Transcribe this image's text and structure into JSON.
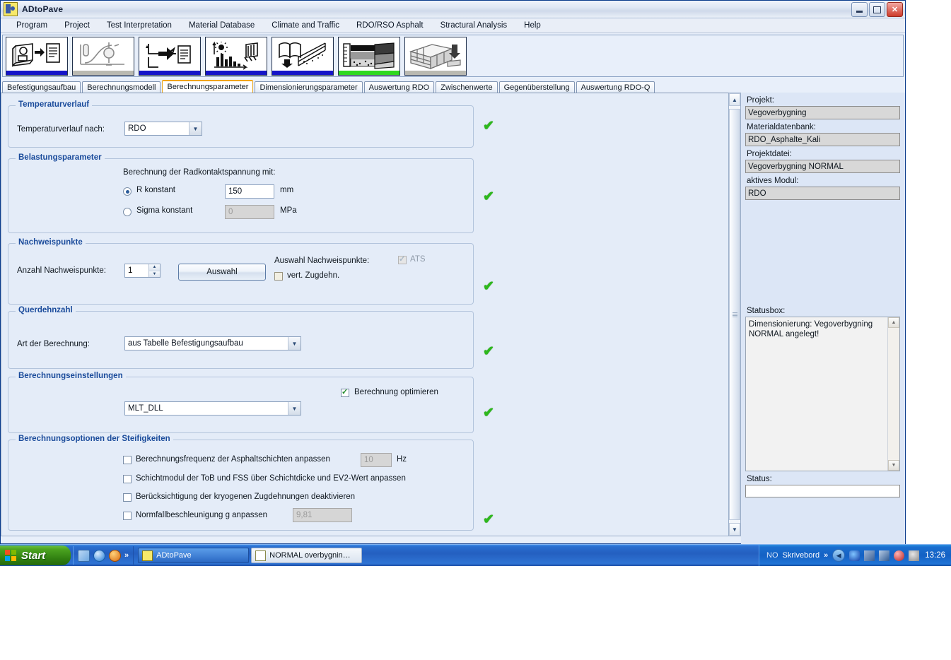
{
  "window": {
    "title": "ADtoPave",
    "app_icon": "app-icon",
    "controls": {
      "minimize": "Minimize",
      "maximize": "Maximize",
      "close": "Close"
    }
  },
  "menubar": {
    "items": [
      "Program",
      "Project",
      "Test Interpretation",
      "Material Database",
      "Climate and Traffic",
      "RDO/RSO Asphalt",
      "Stractural Analysis",
      "Help"
    ]
  },
  "toolbar": {
    "buttons": [
      {
        "name": "project-data-icon",
        "bar": "blue"
      },
      {
        "name": "test-interpretation-icon",
        "bar": "gray"
      },
      {
        "name": "material-flow-icon",
        "bar": "blue"
      },
      {
        "name": "climate-traffic-icon",
        "bar": "blue"
      },
      {
        "name": "material-database-icon",
        "bar": "blue"
      },
      {
        "name": "rdo-rso-asphalt-icon",
        "bar": "green"
      },
      {
        "name": "structural-analysis-icon",
        "bar": "gray"
      }
    ]
  },
  "tabs": [
    {
      "label": "Befestigungsaufbau",
      "active": false
    },
    {
      "label": "Berechnungsmodell",
      "active": false
    },
    {
      "label": "Berechnungsparameter",
      "active": true
    },
    {
      "label": "Dimensionierungsparameter",
      "active": false
    },
    {
      "label": "Auswertung RDO",
      "active": false
    },
    {
      "label": "Zwischenwerte",
      "active": false
    },
    {
      "label": "Gegenüberstellung",
      "active": false
    },
    {
      "label": "Auswertung RDO-Q",
      "active": false
    }
  ],
  "form": {
    "temperature": {
      "legend": "Temperaturverlauf",
      "label": "Temperaturverlauf nach:",
      "combo_value": "RDO",
      "status": "✔"
    },
    "load": {
      "legend": "Belastungsparameter",
      "heading": "Berechnung der Radkontaktspannung mit:",
      "radio_r_label": "R konstant",
      "radio_r_selected": true,
      "r_value": "150",
      "r_unit": "mm",
      "radio_sigma_label": "Sigma konstant",
      "radio_sigma_selected": false,
      "sigma_value": "0",
      "sigma_unit": "MPa",
      "status": "✔"
    },
    "points": {
      "legend": "Nachweispunkte",
      "count_label": "Anzahl Nachweispunkte:",
      "count_value": "1",
      "button_label": "Auswahl",
      "selection_label": "Auswahl Nachweispunkte:",
      "ats_label": "ATS",
      "ats_checked": true,
      "vert_label": "vert. Zugdehn.",
      "vert_checked": false,
      "status": "✔"
    },
    "poisson": {
      "legend": "Querdehnzahl",
      "label": "Art der Berechnung:",
      "combo_value": "aus Tabelle Befestigungsaufbau",
      "status": "✔"
    },
    "settings": {
      "legend": "Berechnungseinstellungen",
      "combo_value": "MLT_DLL",
      "optimize_label": "Berechnung optimieren",
      "optimize_checked": true,
      "status": "✔"
    },
    "stiffness": {
      "legend": "Berechnungsoptionen der Steifigkeiten",
      "opt1_label": "Berechnungsfrequenz der Asphaltschichten anpassen",
      "opt1_checked": false,
      "opt1_value": "10",
      "opt1_unit": "Hz",
      "opt2_label": "Schichtmodul der ToB und FSS über Schichtdicke und EV2-Wert anpassen",
      "opt2_checked": false,
      "opt3_label": "Berücksichtigung der kryogenen Zugdehnungen deaktivieren",
      "opt3_checked": false,
      "opt4_label": "Normfallbeschleunigung g anpassen",
      "opt4_checked": false,
      "opt4_value": "9,81",
      "status": "✔"
    }
  },
  "sidebar": {
    "project_label": "Projekt:",
    "project_value": "Vegoverbygning",
    "materialdb_label": "Materialdatenbank:",
    "materialdb_value": "RDO_Asphalte_Kali",
    "projectfile_label": "Projektdatei:",
    "projectfile_value": "Vegoverbygning NORMAL",
    "module_label": "aktives Modul:",
    "module_value": "RDO",
    "statusbox_label": "Statusbox:",
    "statusbox_text": "Dimensionierung: Vegoverbygning NORMAL angelegt!",
    "status_label": "Status:",
    "status_value": ""
  },
  "taskbar": {
    "start_label": "Start",
    "quicklaunch": [
      {
        "name": "show-desktop-icon"
      },
      {
        "name": "internet-explorer-icon"
      },
      {
        "name": "media-player-icon"
      }
    ],
    "quicklaunch_more": "»",
    "tasks": [
      {
        "label": "ADtoPave",
        "icon": "adtopave-icon",
        "active": true
      },
      {
        "label": "NORMAL overbygnin…",
        "icon": "document-icon",
        "active": false
      }
    ],
    "tray": {
      "language": "NO",
      "toolbar_label": "Skrivebord",
      "more": "»",
      "icons": [
        "hide-icons-chevron",
        "network-sync-icon",
        "network-disconnected-icon",
        "volume-icon",
        "security-alert-icon",
        "antivirus-icon"
      ],
      "clock": "13:26"
    }
  },
  "colors": {
    "accent": "#1a4b9b",
    "ok_green": "#2db81c",
    "panel_bg": "#e4ecf8",
    "sidebar_bg": "#dce6f6",
    "active_tab_border": "#f0a41b"
  }
}
